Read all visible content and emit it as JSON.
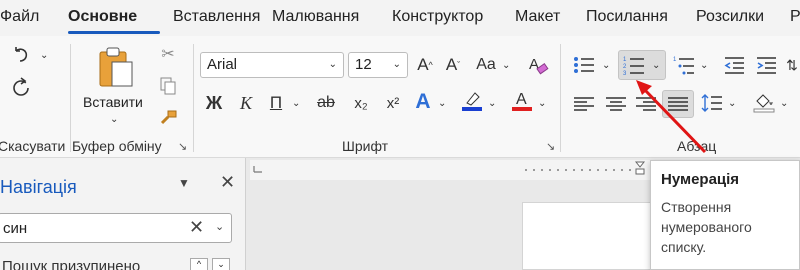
{
  "tabs": [
    {
      "label": "Файл"
    },
    {
      "label": "Основне"
    },
    {
      "label": "Вставлення"
    },
    {
      "label": "Малювання"
    },
    {
      "label": "Конструктор"
    },
    {
      "label": "Макет"
    },
    {
      "label": "Посилання"
    },
    {
      "label": "Розсилки"
    },
    {
      "label": "Р"
    }
  ],
  "undo_group": {
    "label": "Скасувати"
  },
  "clipboard": {
    "paste_label": "Вставити",
    "group_label": "Буфер обміну"
  },
  "font": {
    "name": "Arial",
    "size": "12",
    "group_label": "Шрифт",
    "grow_glyph": "A^",
    "shrink_glyph": "A˅",
    "case_glyph": "Aa",
    "bold": "Ж",
    "italic": "К",
    "underline": "П",
    "strike": "ab",
    "sub": "x₂",
    "sup": "x²",
    "effects": "A",
    "highlight": "A",
    "fontcolor": "A",
    "highlight_color": "#1a3fd1",
    "fontcolor_color": "#e02020"
  },
  "paragraph": {
    "group_label": "Абзац"
  },
  "navigation": {
    "title": "Навігація",
    "search_value": "син",
    "option": "Пошук призупинено"
  },
  "tooltip": {
    "title": "Нумерація",
    "body": "Створення нумерованого списку."
  },
  "colors": {
    "accent": "#185abd",
    "arrow": "#e01515"
  }
}
